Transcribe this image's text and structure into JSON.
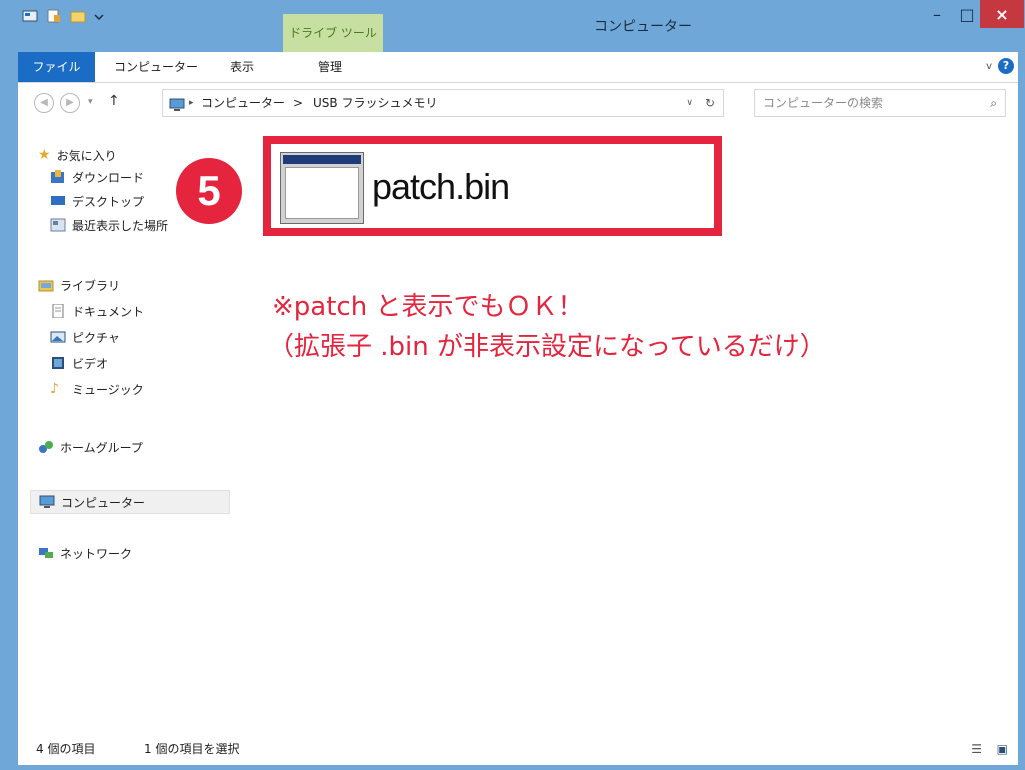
{
  "window": {
    "title": "コンピューター",
    "context_tab": "ドライブ ツール",
    "controls": {
      "minimize": "–",
      "maximize": "□",
      "close": "×"
    }
  },
  "ribbon": {
    "tabs": [
      "ファイル",
      "コンピューター",
      "表示",
      "管理"
    ],
    "help": "?",
    "expand": "v"
  },
  "address_bar": {
    "crumbs": [
      "コンピューター",
      "USB フラッシュメモリ"
    ],
    "separator": ">",
    "search_placeholder": "コンピューターの検索"
  },
  "sidebar": {
    "favorites": {
      "label": "お気に入り",
      "items": [
        "ダウンロード",
        "デスクトップ",
        "最近表示した場所"
      ]
    },
    "libraries": {
      "label": "ライブラリ",
      "items": [
        "ドキュメント",
        "ピクチャ",
        "ビデオ",
        "ミュージック"
      ]
    },
    "homegroup": "ホームグループ",
    "computer": "コンピューター",
    "network": "ネットワーク"
  },
  "content": {
    "file_name": "patch.bin",
    "step_number": "5",
    "note_line1": "※patch と表示でもＯＫ！",
    "note_line2": "（拡張子 .bin が非表示設定になっているだけ）",
    "highlight_color": "#e5243e"
  },
  "status": {
    "item_count": "4 個の項目",
    "selected": "1 個の項目を選択"
  }
}
